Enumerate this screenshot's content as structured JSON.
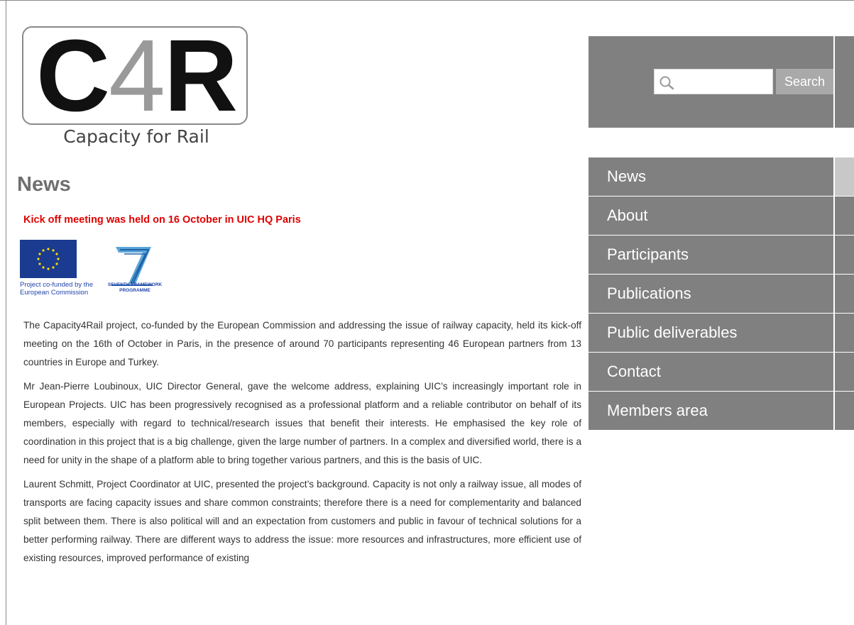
{
  "site": {
    "logo_letters": [
      "C",
      "4",
      "R"
    ],
    "logo_tagline": "Capacity for Rail"
  },
  "search": {
    "placeholder": "",
    "button_label": "Search",
    "icon": "search-icon"
  },
  "nav": {
    "items": [
      {
        "label": "News",
        "active": true
      },
      {
        "label": "About",
        "active": false
      },
      {
        "label": "Participants",
        "active": false
      },
      {
        "label": "Publications",
        "active": false
      },
      {
        "label": "Public deliverables",
        "active": false
      },
      {
        "label": "Contact",
        "active": false
      },
      {
        "label": "Members area",
        "active": false
      }
    ]
  },
  "content": {
    "page_title": "News",
    "headline": "Kick off meeting was held on 16 October in UIC HQ Paris",
    "funding": {
      "eu_caption": "Project co-funded by the European Commission",
      "fp7_caption": "SEVENTH FRAMEWORK PROGRAMME"
    },
    "paragraphs": [
      "The Capacity4Rail project, co-funded by the European Commission and addressing the issue of railway capacity, held its kick-off meeting on the 16th of October in Paris, in the presence of around 70 participants representing 46 European partners from 13 countries in Europe and Turkey.",
      "Mr Jean-Pierre Loubinoux, UIC Director General, gave the welcome address, explaining UIC’s increasingly important role in European Projects. UIC has been progressively recognised as a professional platform and a reliable contributor on behalf of its members, especially with regard to technical/research issues that benefit their interests. He emphasised the key role of coordination in this project that is a big challenge, given the large number of partners. In a complex and diversified world, there is a need for unity in the shape of a platform able to bring together various partners, and this is the basis of UIC.",
      "Laurent Schmitt, Project Coordinator at UIC, presented the project’s background. Capacity is not only a railway issue, all modes of transports are facing capacity issues and share common constraints; therefore there is a need for complementarity and balanced split between them. There is also political will and an expectation from customers and public in favour of technical solutions for a better performing railway. There are different ways to address the issue: more resources and infrastructures, more efficient use of existing resources, improved performance of existing"
    ]
  },
  "colors": {
    "panel_gray": "#808080",
    "active_tab": "#c8c8c8",
    "headline_red": "#e00000",
    "title_gray": "#6f6f6f"
  }
}
